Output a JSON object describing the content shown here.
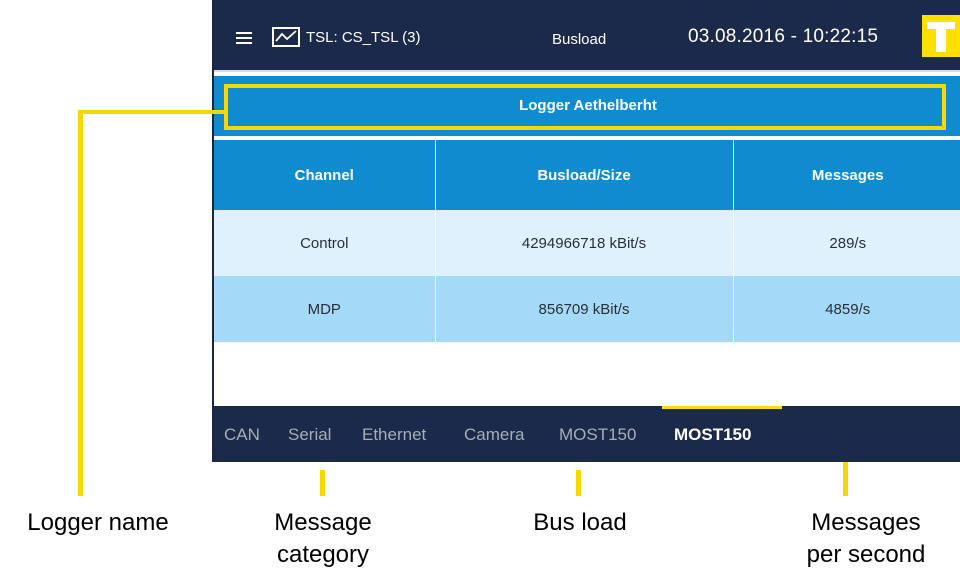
{
  "app": {
    "tsl_label": "TSL: CS_TSL (3)",
    "page_title": "Busload",
    "datetime": "03.08.2016 - 10:22:15"
  },
  "logger_name": "Logger Aethelberht",
  "table": {
    "headers": [
      "Channel",
      "Busload/Size",
      "Messages"
    ],
    "rows": [
      [
        "Control",
        "4294966718 kBit/s",
        "289/s"
      ],
      [
        "MDP",
        "856709 kBit/s",
        "4859/s"
      ]
    ]
  },
  "tabs": {
    "items": [
      "CAN",
      "Serial",
      "Ethernet",
      "Camera",
      "MOST150",
      "MOST150"
    ],
    "active_index": 5
  },
  "annotations": {
    "logger_name": "Logger name",
    "message_category_1": "Message",
    "message_category_2": "category",
    "bus_load": "Bus load",
    "messages_per_second_1": "Messages",
    "messages_per_second_2": "per second"
  },
  "colors": {
    "header_bar": "#1b2a4a",
    "accent_blue": "#0f8bd0",
    "row_light": "#def1fd",
    "row_mid": "#a4daf7",
    "highlight_yellow": "#f7d900"
  },
  "icons": [
    "menu-icon",
    "line-chart-icon",
    "t-logo-icon"
  ]
}
